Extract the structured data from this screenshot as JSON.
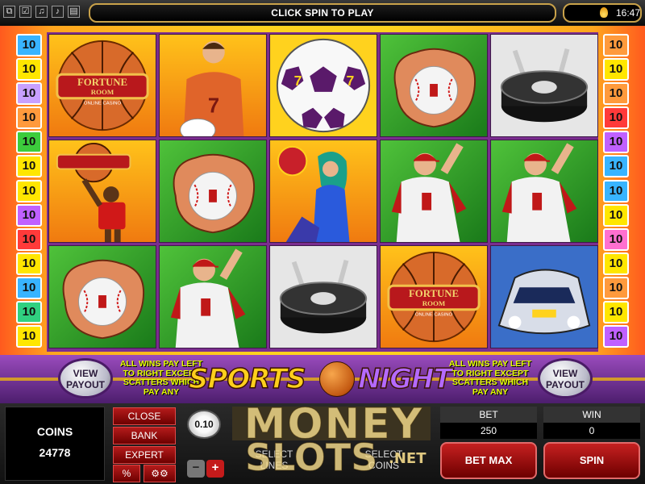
{
  "top_bar": {
    "message": "CLICK SPIN TO PLAY",
    "clock": "16:47",
    "left_icons": [
      "windows-icon",
      "checkbox-icon",
      "sound-icon",
      "settings-icon"
    ]
  },
  "paylines": {
    "left": [
      "10",
      "10",
      "10",
      "10",
      "10",
      "10",
      "10",
      "10",
      "10",
      "10",
      "10",
      "10",
      "10"
    ],
    "right": [
      "10",
      "10",
      "10",
      "10",
      "10",
      "10",
      "10",
      "10",
      "10",
      "10",
      "10",
      "10",
      "10"
    ],
    "left_colors": [
      "#38b4ff",
      "#ffe600",
      "#c8a0ff",
      "#ff9a3c",
      "#3ccc3c",
      "#ffe600",
      "#ffe600",
      "#c060ff",
      "#ff3a3a",
      "#ffe600",
      "#38b4ff",
      "#30d080",
      "#ffe600"
    ],
    "right_colors": [
      "#ff9a3c",
      "#ffe600",
      "#ff9a3c",
      "#ff3a3a",
      "#c060ff",
      "#38b4ff",
      "#38b4ff",
      "#ffe600",
      "#ff70d0",
      "#ffe600",
      "#ff9a3c",
      "#ffe600",
      "#c060ff"
    ]
  },
  "reels": [
    [
      "basketball-logo",
      "basketball-player",
      "baseball-glove"
    ],
    [
      "soccer-player",
      "baseball-glove",
      "baseball-pitcher"
    ],
    [
      "soccer-ball",
      "race-girl",
      "hockey-puck"
    ],
    [
      "baseball-glove",
      "baseball-pitcher",
      "basketball-logo"
    ],
    [
      "hockey-puck",
      "baseball-pitcher",
      "race-car"
    ]
  ],
  "symbol_logo_text": {
    "line1": "FORTUNE",
    "line2": "ROOM",
    "line3": "ONLINE CASINO"
  },
  "banner": {
    "view_payout_label": "VIEW PAYOUT",
    "rule_text": "ALL WINS PAY LEFT TO RIGHT EXCEPT SCATTERS WHICH PAY ANY",
    "logo_word1": "SPORTS",
    "logo_word2": "NIGHT"
  },
  "panel": {
    "coins_label": "COINS",
    "coins_value": "24778",
    "close_label": "CLOSE",
    "bank_label": "BANK",
    "expert_label": "EXPERT",
    "percent_label": "%",
    "coin_size": "0.10",
    "minus_label": "−",
    "plus_label": "+",
    "select_lines_label": "SELECT LINES",
    "select_coins_label": "SELECT COINS",
    "bet_label": "BET",
    "bet_value": "250",
    "win_label": "WIN",
    "win_value": "0",
    "bet_max_label": "BET MAX",
    "spin_label": "SPIN"
  },
  "watermark": {
    "line1": "MONEY",
    "line2": "SLOTS",
    "line3": ".NET"
  },
  "colors": {
    "reel_border": "#7b2d8f",
    "button_red": "#b51b1b",
    "accent_gold": "#c9a24a"
  }
}
